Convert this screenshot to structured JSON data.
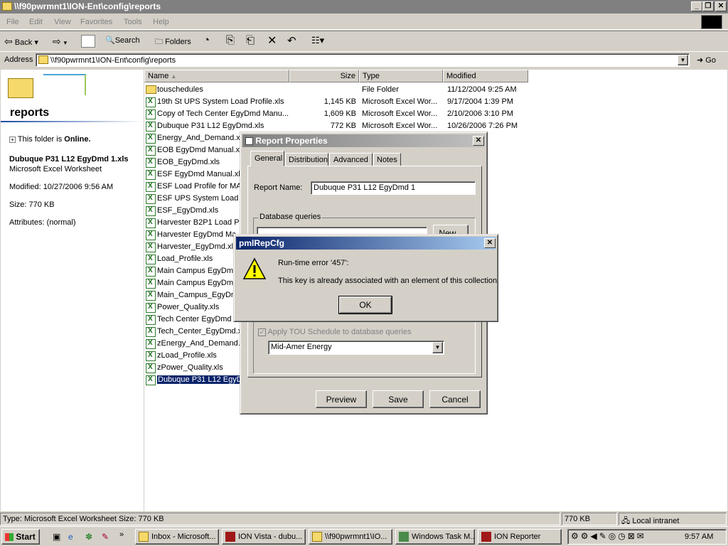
{
  "window": {
    "title": "\\\\f90pwrmnt1\\ION-Ent\\config\\reports"
  },
  "menu": [
    "File",
    "Edit",
    "View",
    "Favorites",
    "Tools",
    "Help"
  ],
  "toolbar": {
    "back": "Back",
    "search": "Search",
    "folders": "Folders"
  },
  "address": {
    "label": "Address",
    "value": "\\\\f90pwrmnt1\\ION-Ent\\config\\reports",
    "go": "Go"
  },
  "left_pane": {
    "folder_title": "reports",
    "online_prefix": "This folder is ",
    "online_state": "Online.",
    "selected_name": "Dubuque P31 L12 EgyDmd 1.xls",
    "selected_type": "Microsoft Excel Worksheet",
    "modified": "Modified: 10/27/2006 9:56 AM",
    "size": "Size: 770 KB",
    "attributes": "Attributes: (normal)"
  },
  "columns": {
    "name": "Name",
    "size": "Size",
    "type": "Type",
    "modified": "Modified"
  },
  "files": [
    {
      "name": "touschedules",
      "size": "",
      "type": "File Folder",
      "modified": "11/12/2004 9:25 AM",
      "icon": "folder"
    },
    {
      "name": "19th St UPS System Load Profile.xls",
      "size": "1,145 KB",
      "type": "Microsoft Excel Wor...",
      "modified": "9/17/2004 1:39 PM",
      "icon": "excel"
    },
    {
      "name": "Copy of Tech Center EgyDmd Manu...",
      "size": "1,609 KB",
      "type": "Microsoft Excel Wor...",
      "modified": "2/10/2006 3:10 PM",
      "icon": "excel"
    },
    {
      "name": "Dubuque P31 L12 EgyDmd.xls",
      "size": "772 KB",
      "type": "Microsoft Excel Wor...",
      "modified": "10/26/2006 7:26 PM",
      "icon": "excel"
    },
    {
      "name": "Energy_And_Demand.xl",
      "size": "",
      "type": "",
      "modified": ":42 PM",
      "icon": "excel"
    },
    {
      "name": "EOB EgyDmd Manual.xls",
      "size": "",
      "type": "",
      "modified": ":21 AM",
      "icon": "excel"
    },
    {
      "name": "EOB_EgyDmd.xls",
      "size": "",
      "type": "",
      "modified": ":21 AM",
      "icon": "excel"
    },
    {
      "name": "ESF EgyDmd Manual.xls",
      "size": "",
      "type": "",
      "modified": ":24 PM",
      "icon": "excel"
    },
    {
      "name": "ESF Load Profile for MA",
      "size": "",
      "type": "",
      "modified": ":30 PM",
      "icon": "excel"
    },
    {
      "name": "ESF UPS System Load Pr",
      "size": "",
      "type": "",
      "modified": "8:39 AM",
      "icon": "excel"
    },
    {
      "name": "ESF_EgyDmd.xls",
      "size": "",
      "type": "",
      "modified": "3:03 PM",
      "icon": "excel"
    },
    {
      "name": "Harvester B2P1 Load Pro",
      "size": "",
      "type": "",
      "modified": ":24 PM",
      "icon": "excel"
    },
    {
      "name": "Harvester EgyDmd Ma",
      "size": "",
      "type": "",
      "modified": "",
      "icon": "excel"
    },
    {
      "name": "Harvester_EgyDmd.xl",
      "size": "",
      "type": "",
      "modified": "",
      "icon": "excel"
    },
    {
      "name": "Load_Profile.xls",
      "size": "",
      "type": "",
      "modified": "",
      "icon": "excel"
    },
    {
      "name": "Main Campus EgyDmd",
      "size": "",
      "type": "",
      "modified": "PM",
      "icon": "excel"
    },
    {
      "name": "Main Campus EgyDmd",
      "size": "",
      "type": "",
      "modified": "",
      "icon": "excel"
    },
    {
      "name": "Main_Campus_EgyDm",
      "size": "",
      "type": "",
      "modified": "",
      "icon": "excel"
    },
    {
      "name": "Power_Quality.xls",
      "size": "",
      "type": "",
      "modified": "",
      "icon": "excel"
    },
    {
      "name": "Tech Center EgyDmd",
      "size": "",
      "type": "",
      "modified": "",
      "icon": "excel"
    },
    {
      "name": "Tech_Center_EgyDmd.x",
      "size": "",
      "type": "",
      "modified": "3:09 PM",
      "icon": "excel"
    },
    {
      "name": "zEnergy_And_Demand.x",
      "size": "",
      "type": "",
      "modified": "3:28 PM",
      "icon": "excel"
    },
    {
      "name": "zLoad_Profile.xls",
      "size": "",
      "type": "",
      "modified": "3:29 PM",
      "icon": "excel"
    },
    {
      "name": "zPower_Quality.xls",
      "size": "",
      "type": "",
      "modified": "3:28 PM",
      "icon": "excel"
    },
    {
      "name": "Dubuque P31 L12 EgyDr",
      "size": "",
      "type": "",
      "modified": "9:56 AM",
      "icon": "excel",
      "selected": true
    }
  ],
  "report_dialog": {
    "title": "Report Properties",
    "tabs": [
      "General",
      "Distribution",
      "Advanced",
      "Notes"
    ],
    "report_name_label": "Report Name:",
    "report_name_value": "Dubuque P31 L12 EgyDmd 1",
    "db_queries_label": "Database queries",
    "new_button": "New...",
    "tou_checkbox": "Apply TOU Schedule to database queries",
    "tou_select": "Mid-Amer Energy",
    "preview_button": "Preview",
    "save_button": "Save",
    "cancel_button": "Cancel"
  },
  "error_dialog": {
    "title": "pmlRepCfg",
    "line1": "Run-time error '457':",
    "line2": "This key is already associated with an element of this collection",
    "ok": "OK"
  },
  "status": {
    "left": "Type: Microsoft Excel Worksheet Size: 770 KB",
    "size": "770 KB",
    "zone": "Local intranet"
  },
  "taskbar": {
    "start": "Start",
    "tasks": [
      "Inbox - Microsoft...",
      "ION Vista - dubu...",
      "\\\\f90pwrmnt1\\IO...",
      "Windows Task M...",
      "ION Reporter"
    ],
    "clock": "9:57 AM"
  },
  "colors": {
    "title_active": "#0a246a",
    "title_active2": "#a6caf0",
    "title_inactive": "#808080",
    "selection": "#0a246a"
  }
}
